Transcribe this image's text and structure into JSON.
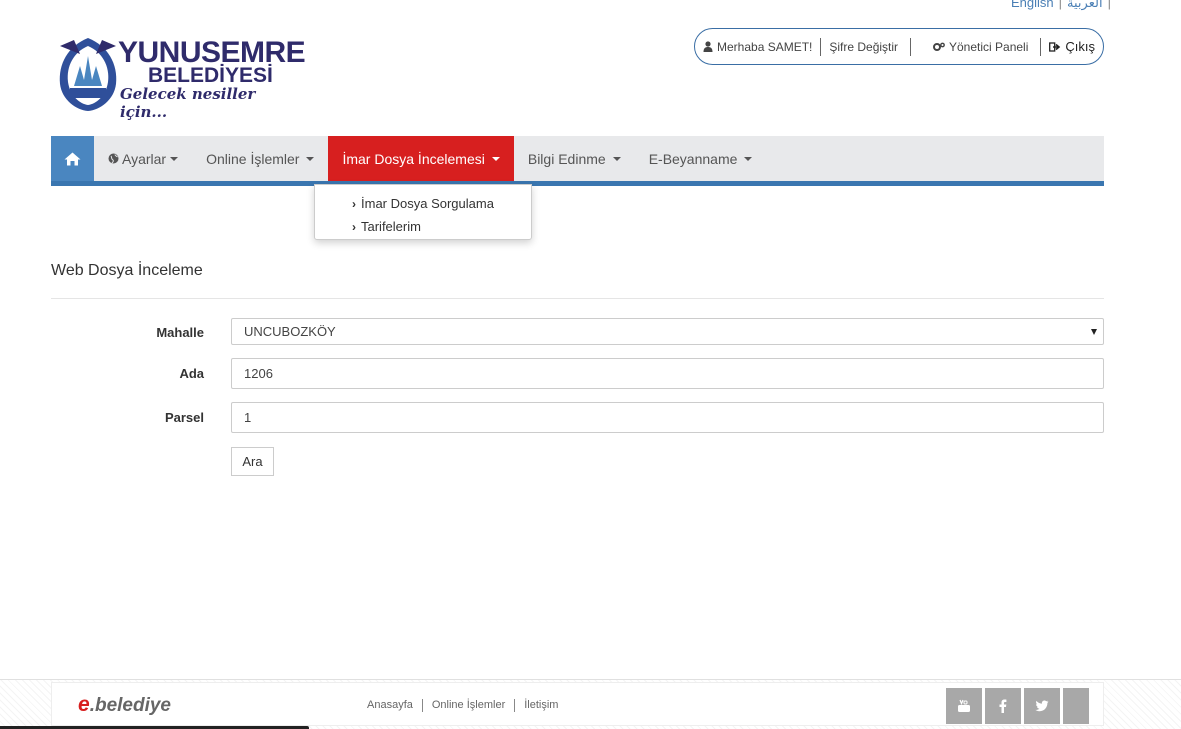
{
  "lang": {
    "english": "English",
    "arabic": "العربية"
  },
  "logo": {
    "title": "YUNUSEMRE",
    "subtitle": "BELEDİYESİ",
    "slogan": "Gelecek nesiller için..."
  },
  "userbar": {
    "greeting": "Merhaba SAMET!",
    "change_password": "Şifre Değiştir",
    "admin_panel": "Yönetici Paneli",
    "logout": "Çıkış"
  },
  "nav": {
    "items": [
      {
        "label": "Ayarlar"
      },
      {
        "label": "Online İşlemler"
      },
      {
        "label": "İmar Dosya İncelemesi"
      },
      {
        "label": "Bilgi Edinme"
      },
      {
        "label": "E-Beyanname"
      }
    ],
    "dropdown": [
      "İmar Dosya Sorgulama",
      "Tarifelerim"
    ]
  },
  "page": {
    "title": "Web Dosya İnceleme"
  },
  "form": {
    "mahalle_label": "Mahalle",
    "mahalle_value": "UNCUBOZKÖY",
    "ada_label": "Ada",
    "ada_value": "1206",
    "parsel_label": "Parsel",
    "parsel_value": "1",
    "search_button": "Ara"
  },
  "footer": {
    "brand_e": "e",
    "brand_rest": ".belediye",
    "links": [
      "Anasayfa",
      "Online İşlemler",
      "İletişim"
    ],
    "social_icons": [
      "youtube-icon",
      "facebook-icon",
      "twitter-icon",
      "more-icon"
    ]
  },
  "colors": {
    "nav_active": "#d71f1f",
    "nav_home": "#4a86c0",
    "brand_dark": "#2f2b6b"
  }
}
